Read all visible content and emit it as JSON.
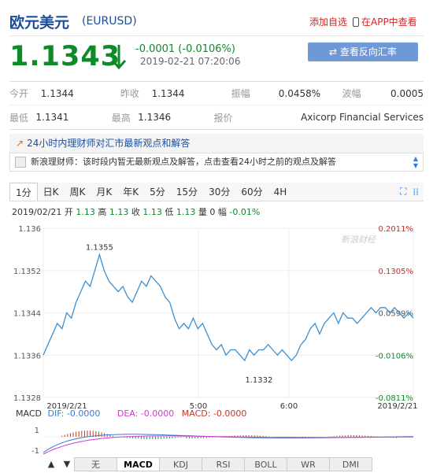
{
  "header": {
    "title": "欧元美元",
    "code": "(EURUSD)",
    "add_favorite": "添加自选",
    "view_in_app": "在APP中查看"
  },
  "quote": {
    "price": "1.1343",
    "change": "-0.0001 (-0.0106%)",
    "time": "2019-02-21 07:20:06",
    "reverse_button": "查看反向汇率 USDEUR"
  },
  "stats": {
    "row1": [
      {
        "label": "今开",
        "value": "1.1344"
      },
      {
        "label": "昨收",
        "value": "1.1344"
      },
      {
        "label": "振幅",
        "value": "0.0458%"
      },
      {
        "label": "波幅",
        "value": "0.0005"
      }
    ],
    "row2": [
      {
        "label": "最低",
        "value": "1.1341"
      },
      {
        "label": "最高",
        "value": "1.1346"
      },
      {
        "label": "报价",
        "value": ""
      },
      {
        "label": "",
        "value": "Axicorp Financial Services"
      }
    ]
  },
  "news": {
    "headline": "24小时内理财师对汇市最新观点和解答",
    "message": "新浪理财师：该时段内暂无最新观点及解答，点击查看24小时之前的观点及解答"
  },
  "tabs": [
    "1分",
    "日K",
    "周K",
    "月K",
    "年K",
    "5分",
    "15分",
    "30分",
    "60分",
    "4H"
  ],
  "active_tab": "1分",
  "ohlc": {
    "date": "2019/02/21",
    "open_label": "开",
    "open": "1.13",
    "high_label": "高",
    "high": "1.13",
    "close_label": "收",
    "close": "1.13",
    "low_label": "低",
    "low": "1.13",
    "vol_label": "量",
    "vol": "0",
    "amp_label": "幅",
    "amp": "-0.01%"
  },
  "chart_data": {
    "type": "line",
    "y_ticks": [
      "1.136",
      "1.1352",
      "1.1344",
      "1.1336",
      "1.1328"
    ],
    "right_ticks": [
      "0.2011%",
      "0.1305%",
      "0.0599%",
      "-0.0106%",
      "-0.0811%"
    ],
    "x_ticks": [
      "2019/2/21",
      "5:00",
      "6:00",
      "2019/2/21"
    ],
    "ylim": [
      1.1328,
      1.136
    ],
    "annotations": [
      {
        "label": "1.1355"
      },
      {
        "label": "1.1332"
      }
    ],
    "watermark": "新浪财经",
    "color": "#3b8fd0",
    "series": [
      {
        "values": [
          1.1336,
          1.1338,
          1.134,
          1.1342,
          1.1341,
          1.1344,
          1.1343,
          1.1346,
          1.1348,
          1.135,
          1.1349,
          1.1352,
          1.1355,
          1.1352,
          1.135,
          1.1349,
          1.1348,
          1.1349,
          1.1347,
          1.1346,
          1.1348,
          1.135,
          1.1349,
          1.1351,
          1.135,
          1.1349,
          1.1347,
          1.1346,
          1.1343,
          1.1341,
          1.1342,
          1.1341,
          1.1343,
          1.1341,
          1.1342,
          1.134,
          1.1338,
          1.1337,
          1.1338,
          1.1336,
          1.1337,
          1.1337,
          1.1336,
          1.1335,
          1.1337,
          1.1336,
          1.1337,
          1.1337,
          1.1338,
          1.1337,
          1.1336,
          1.1337,
          1.1336,
          1.1335,
          1.1336,
          1.1338,
          1.1339,
          1.1341,
          1.1342,
          1.134,
          1.1342,
          1.1343,
          1.1344,
          1.1342,
          1.1344,
          1.1343,
          1.1343,
          1.1342,
          1.1343,
          1.1344,
          1.1345,
          1.1344,
          1.1345,
          1.1345,
          1.1344,
          1.1345,
          1.1344,
          1.1343,
          1.1344,
          1.1343
        ]
      }
    ]
  },
  "macd": {
    "label": "MACD",
    "dif": "DIF: -0.0000",
    "dea": "DEA: -0.0000",
    "macd": "MACD: -0.0000",
    "y_ticks": [
      "1",
      "-1"
    ]
  },
  "indicators": [
    "无",
    "MACD",
    "KDJ",
    "RSI",
    "BOLL",
    "WR",
    "DMI"
  ],
  "active_indicator": "MACD"
}
